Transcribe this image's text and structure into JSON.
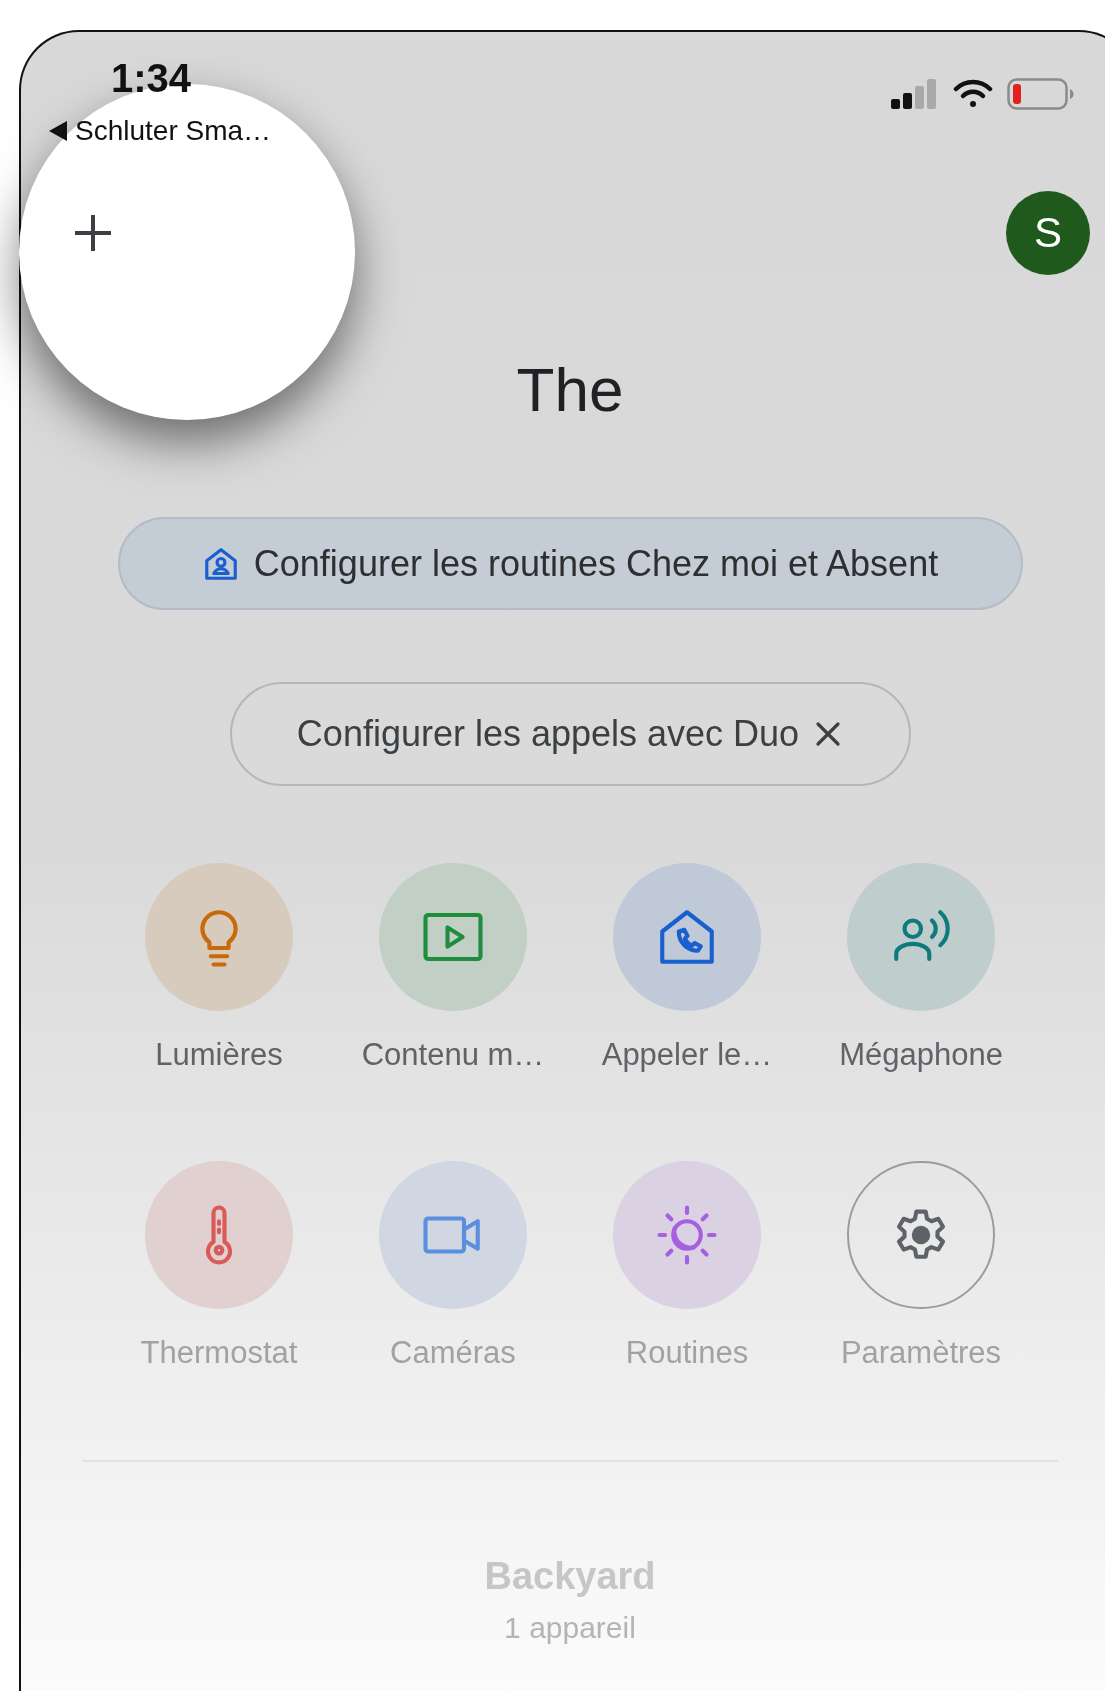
{
  "status_bar": {
    "time": "1:34",
    "back_label": "Schluter Sma…"
  },
  "avatar": {
    "initial": "S"
  },
  "title": "The",
  "chips": [
    {
      "kind": "routine",
      "label": "Configurer les routines Chez moi et Absent"
    },
    {
      "kind": "dismissible",
      "label": "Configurer les appels avec Duo"
    }
  ],
  "shortcuts": [
    {
      "kind": "bulb",
      "label": "Lumières",
      "color": "#c96a0a"
    },
    {
      "kind": "play",
      "label": "Contenu m…",
      "color": "#1e8e3e"
    },
    {
      "kind": "house-phone",
      "label": "Appeler le…",
      "color": "#1a5fd0"
    },
    {
      "kind": "broadcast",
      "label": "Mégaphone",
      "color": "#10797d"
    },
    {
      "kind": "thermometer",
      "label": "Thermostat",
      "color": "#d95a56"
    },
    {
      "kind": "camera",
      "label": "Caméras",
      "color": "#5a8fe0"
    },
    {
      "kind": "sun-moon",
      "label": "Routines",
      "color": "#a560e0"
    },
    {
      "kind": "gear",
      "label": "Paramètres",
      "color": "#5f6368"
    }
  ],
  "room": {
    "name": "Backyard",
    "count": "1 appareil"
  }
}
